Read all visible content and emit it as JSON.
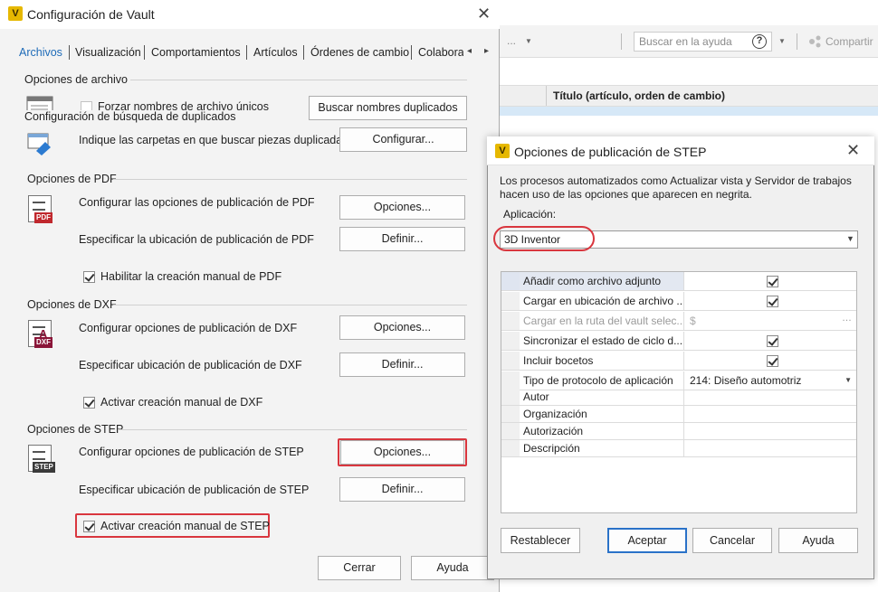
{
  "background_app": {
    "toolbar_dots": "...",
    "search_placeholder": "Buscar en la ayuda",
    "help_icon_glyph": "?",
    "share_label": "Compartir",
    "column_title": "Título (artículo, orden de cambio)"
  },
  "vault_dialog": {
    "title": "Configuración de Vault",
    "logo_letter": "V",
    "tabs": [
      "Archivos",
      "Visualización",
      "Comportamientos",
      "Artículos",
      "Órdenes de cambio",
      "Colabora"
    ],
    "active_tab": "Archivos",
    "file_options": {
      "title": "Opciones de archivo",
      "force_unique_label": "Forzar nombres de archivo únicos",
      "force_unique_checked": false,
      "search_dup_button": "Buscar nombres duplicados",
      "dup_search_title": "Configuración de búsqueda de duplicados",
      "dup_folders_label": "Indique las carpetas en que buscar piezas duplicadas.",
      "configure_button": "Configurar..."
    },
    "pdf": {
      "title": "Opciones de PDF",
      "icon_badge": "PDF",
      "configure_label": "Configurar las opciones de publicación de PDF",
      "options_button": "Opciones...",
      "location_label": "Especificar la ubicación de publicación de PDF",
      "define_button": "Definir...",
      "manual_label": "Habilitar la creación manual de PDF",
      "manual_checked": true
    },
    "dxf": {
      "title": "Opciones de DXF",
      "icon_badge": "DXF",
      "configure_label": "Configurar opciones de publicación de DXF",
      "options_button": "Opciones...",
      "location_label": "Especificar ubicación de publicación de DXF",
      "define_button": "Definir...",
      "manual_label": "Activar creación manual de DXF",
      "manual_checked": true
    },
    "step": {
      "title": "Opciones de STEP",
      "icon_badge": "STEP",
      "configure_label": "Configurar opciones de publicación de STEP",
      "options_button": "Opciones...",
      "location_label": "Especificar ubicación de publicación de STEP",
      "define_button": "Definir...",
      "manual_label": "Activar creación manual de STEP",
      "manual_checked": true
    },
    "close_button": "Cerrar",
    "help_button": "Ayuda"
  },
  "step_dialog": {
    "title": "Opciones de publicación de STEP",
    "description": "Los procesos automatizados como Actualizar vista y Servidor de trabajos hacen uso de las opciones que aparecen en negrita.",
    "application_label": "Aplicación:",
    "application_value": "3D Inventor",
    "properties": [
      {
        "name": "Añadir como archivo adjunto",
        "type": "check",
        "checked": true,
        "selected": true
      },
      {
        "name": "Cargar en ubicación de archivo ...",
        "type": "check",
        "checked": true
      },
      {
        "name": "Cargar en la ruta del vault selec...",
        "type": "text",
        "value": "$",
        "disabled": true
      },
      {
        "name": "Sincronizar el estado de ciclo d...",
        "type": "check",
        "checked": true
      },
      {
        "name": "Incluir bocetos",
        "type": "check",
        "checked": true
      },
      {
        "name": "Tipo de protocolo de aplicación",
        "type": "dropdown",
        "value": "214: Diseño automotriz"
      },
      {
        "name": "Autor",
        "type": "text",
        "value": ""
      },
      {
        "name": "Organización",
        "type": "text",
        "value": ""
      },
      {
        "name": "Autorización",
        "type": "text",
        "value": ""
      },
      {
        "name": "Descripción",
        "type": "text",
        "value": ""
      }
    ],
    "reset_button": "Restablecer",
    "ok_button": "Aceptar",
    "cancel_button": "Cancelar",
    "help_button": "Ayuda"
  },
  "colors": {
    "highlight_red": "#d9363e",
    "active_tab": "#1e6bb8",
    "logo_yellow": "#e6b800",
    "pdf_red": "#c0282d",
    "dxf_maroon": "#8a1538",
    "step_dark": "#3a3a3a"
  }
}
